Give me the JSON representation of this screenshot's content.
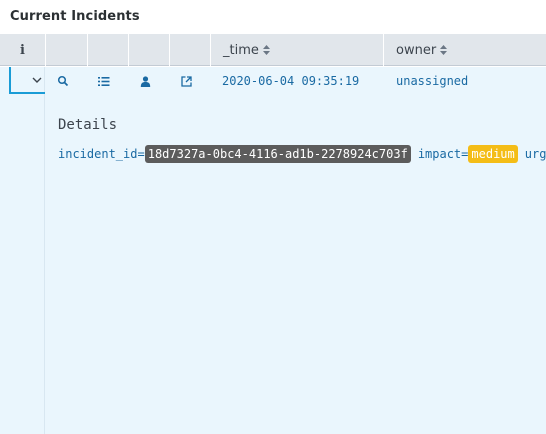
{
  "panel": {
    "title": "Current Incidents"
  },
  "table": {
    "headers": {
      "info": "i",
      "time": "_time",
      "owner": "owner"
    },
    "row": {
      "time": "2020-06-04 09:35:19",
      "owner": "unassigned"
    },
    "details": {
      "title": "Details",
      "fields": [
        {
          "key": "incident_id",
          "sep": "=",
          "value": "18d7327a-0bc4-4116-ad1b-2278924c703f"
        },
        {
          "key": "impact",
          "sep": "=",
          "value": "medium"
        },
        {
          "key": "urgenc",
          "sep": "",
          "value": ""
        }
      ]
    }
  },
  "colors": {
    "accent": "#1a9cd6",
    "row_bg": "#eaf6fd",
    "header_bg": "#e1e6eb",
    "link_text": "#1a6aa3",
    "highlight_dark": "#5c5c5c",
    "highlight_yellow": "#f4bd17"
  },
  "icons": [
    "chevron-down-icon",
    "search-icon",
    "list-icon",
    "user-icon",
    "external-link-icon"
  ]
}
